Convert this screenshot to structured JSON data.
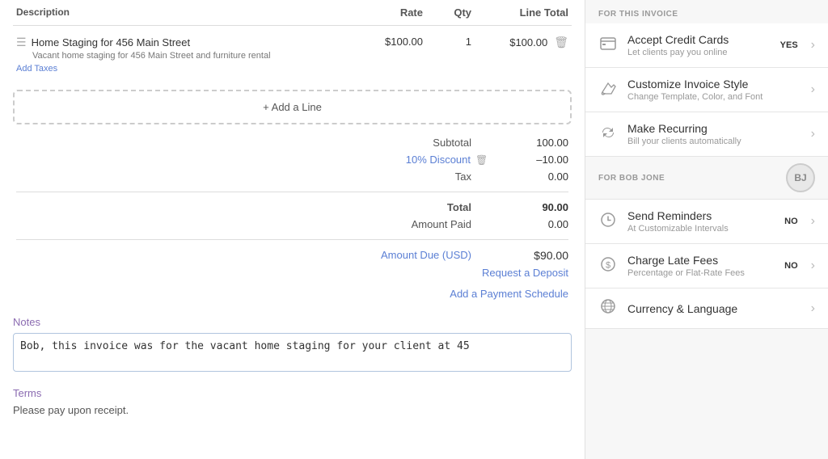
{
  "table": {
    "headers": {
      "description": "Description",
      "rate": "Rate",
      "qty": "Qty",
      "line_total": "Line Total"
    },
    "line_items": [
      {
        "title": "Home Staging for 456 Main Street",
        "subtitle": "Vacant home staging for 456 Main Street and furniture rental",
        "rate": "$100.00",
        "add_taxes": "Add Taxes",
        "qty": "1",
        "total": "$100.00"
      }
    ]
  },
  "add_line_button": "+ Add a Line",
  "totals": {
    "subtotal_label": "Subtotal",
    "subtotal_value": "100.00",
    "discount_label": "10% Discount",
    "discount_value": "–10.00",
    "tax_label": "Tax",
    "tax_value": "0.00",
    "total_label": "Total",
    "total_value": "90.00",
    "amount_paid_label": "Amount Paid",
    "amount_paid_value": "0.00",
    "amount_due_label": "Amount Due (USD)",
    "amount_due_value": "$90.00",
    "request_deposit": "Request a Deposit",
    "payment_schedule": "Add a Payment Schedule"
  },
  "notes": {
    "label": "Notes",
    "value": "Bob, this invoice was for the vacant home staging for your client at 45"
  },
  "terms": {
    "label": "Terms",
    "value": "Please pay upon receipt."
  },
  "right_panel": {
    "for_invoice_title": "FOR THIS INVOICE",
    "items": [
      {
        "id": "accept-credit-cards",
        "icon": "💳",
        "title": "Accept Credit Cards",
        "subtitle": "Let clients pay you online",
        "badge": "YES"
      },
      {
        "id": "customize-invoice-style",
        "icon": "🎨",
        "title": "Customize Invoice Style",
        "subtitle": "Change Template, Color, and Font",
        "badge": ""
      },
      {
        "id": "make-recurring",
        "icon": "🔄",
        "title": "Make Recurring",
        "subtitle": "Bill your clients automatically",
        "badge": ""
      }
    ],
    "for_client_label": "FOR BOB JONE",
    "client_avatar": "BJ",
    "client_items": [
      {
        "id": "send-reminders",
        "icon": "⏰",
        "title": "Send Reminders",
        "subtitle": "At Customizable Intervals",
        "badge": "NO"
      },
      {
        "id": "charge-late-fees",
        "icon": "💲",
        "title": "Charge Late Fees",
        "subtitle": "Percentage or Flat-Rate Fees",
        "badge": "NO"
      },
      {
        "id": "currency-language",
        "icon": "🌐",
        "title": "Currency & Language",
        "subtitle": "",
        "badge": ""
      }
    ]
  }
}
